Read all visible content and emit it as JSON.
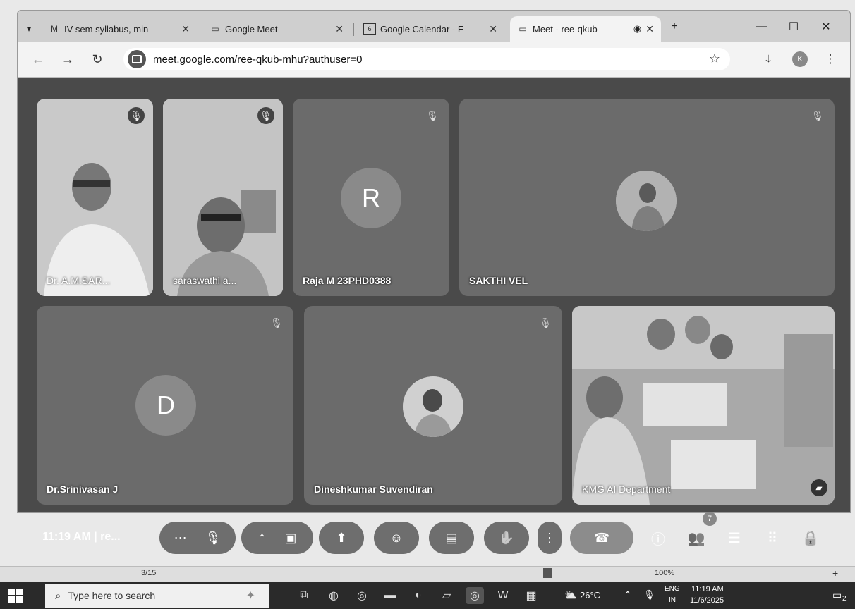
{
  "browser": {
    "tabs": [
      {
        "icon": "gmail-icon",
        "icon_glyph": "M",
        "title": "IV sem syllabus, min"
      },
      {
        "icon": "meet-icon",
        "icon_glyph": "▭",
        "title": "Google Meet"
      },
      {
        "icon": "calendar-icon",
        "icon_glyph": "6",
        "title": "Google Calendar - E"
      },
      {
        "icon": "meet-icon",
        "icon_glyph": "▭",
        "title": "Meet - ree-qkub"
      }
    ],
    "new_tab": "+",
    "url": "meet.google.com/ree-qkub-mhu?authuser=0",
    "profile_initial": "K"
  },
  "participants": [
    {
      "name": "Dr. A.M.SAR...",
      "kind": "video"
    },
    {
      "name": "saraswathi a...",
      "kind": "video"
    },
    {
      "name": "Raja M 23PHD0388",
      "kind": "letter",
      "letter": "R"
    },
    {
      "name": "SAKTHI VEL",
      "kind": "photo"
    },
    {
      "name": "Dr.Srinivasan J",
      "kind": "letter",
      "letter": "D"
    },
    {
      "name": "Dineshkumar Suvendiran",
      "kind": "photo"
    },
    {
      "name": "KMG AI Department",
      "kind": "video"
    }
  ],
  "controls": {
    "time": "11:19 AM",
    "meeting_code": "re...",
    "people_count": "7"
  },
  "pdf": {
    "page": "3/15",
    "zoom": "100%"
  },
  "taskbar": {
    "search_placeholder": "Type here to search",
    "weather": "26°C",
    "lang": "ENG",
    "region": "IN",
    "time": "11:19 AM",
    "date": "11/6/2025",
    "notif_count": "2"
  }
}
